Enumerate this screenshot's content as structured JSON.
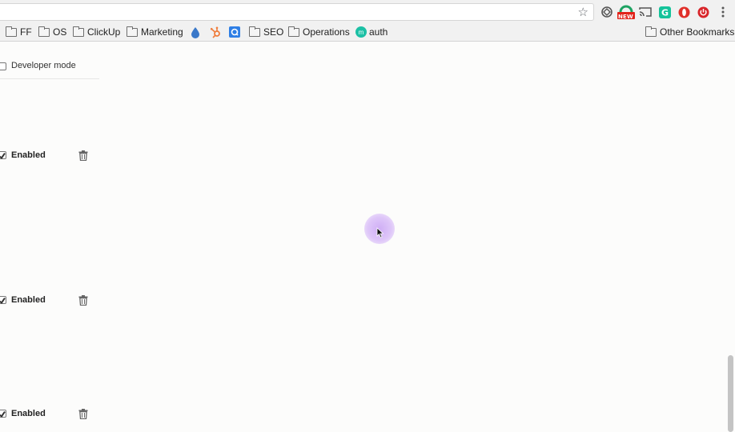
{
  "toolbar": {
    "extensions": [
      "target-icon",
      "new-badge-icon",
      "cast-icon",
      "grammarly-icon",
      "opera-icon",
      "power-icon",
      "menu-dots-icon"
    ],
    "new_badge": "NEW"
  },
  "bookmarks": {
    "items": [
      {
        "label": "FF",
        "icon": "folder-icon"
      },
      {
        "label": "OS",
        "icon": "folder-icon"
      },
      {
        "label": "ClickUp",
        "icon": "folder-icon"
      },
      {
        "label": "Marketing",
        "icon": "folder-icon"
      },
      {
        "label": "",
        "icon": "drop-icon"
      },
      {
        "label": "",
        "icon": "hubspot-icon"
      },
      {
        "label": "",
        "icon": "blue-app-icon"
      },
      {
        "label": "SEO",
        "icon": "folder-icon"
      },
      {
        "label": "Operations",
        "icon": "folder-icon"
      },
      {
        "label": "auth",
        "icon": "m-circle-icon",
        "icon_text": "m"
      }
    ],
    "other": "Other Bookmarks"
  },
  "extensions_page": {
    "developer_mode": {
      "label": "Developer mode",
      "checked": false
    },
    "items": [
      {
        "status": "Enabled",
        "checked": true
      },
      {
        "status": "Enabled",
        "checked": true
      },
      {
        "status": "Enabled",
        "checked": true
      }
    ]
  },
  "colors": {
    "accent_drop": "#3a78c9",
    "hubspot": "#ef7d3c",
    "grammarly": "#15c39a",
    "opera": "#e0302a",
    "auth": "#1cc0a5",
    "cursor_halo": "#d5b8f5"
  }
}
